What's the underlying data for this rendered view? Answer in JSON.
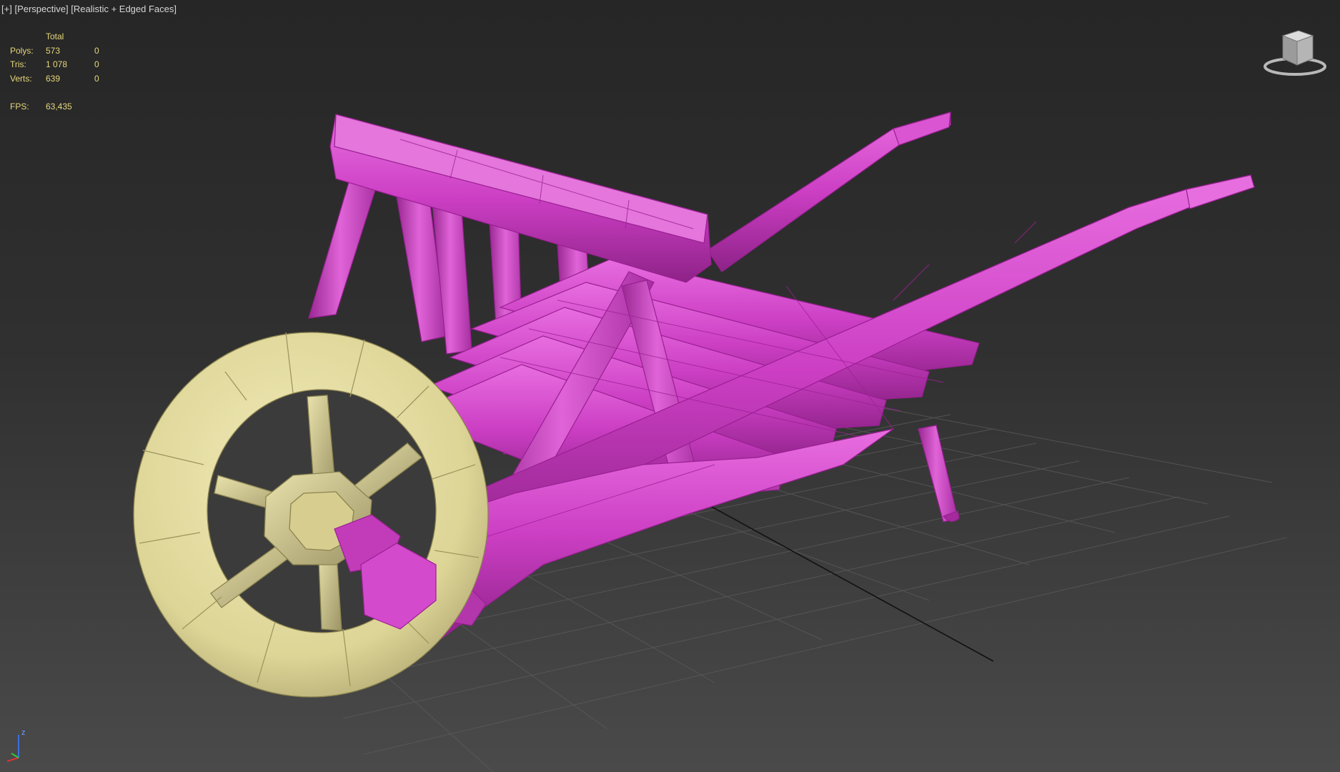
{
  "viewport": {
    "menu_label": "[+]",
    "view_label": "[Perspective]",
    "shading_label": "[Realistic + Edged Faces]"
  },
  "stats": {
    "header": "Total",
    "rows": [
      {
        "label": "Polys:",
        "total": "573",
        "selected": "0"
      },
      {
        "label": "Tris:",
        "total": "1 078",
        "selected": "0"
      },
      {
        "label": "Verts:",
        "total": "639",
        "selected": "0"
      }
    ],
    "fps_label": "FPS:",
    "fps_value": "63,435"
  },
  "axis": {
    "z_label": "z"
  },
  "colors": {
    "body_magenta": "#d040c8",
    "wheel_yellow": "#e4dc98",
    "stats_text": "#e6d77a",
    "grid_line": "#5c5c5c"
  }
}
